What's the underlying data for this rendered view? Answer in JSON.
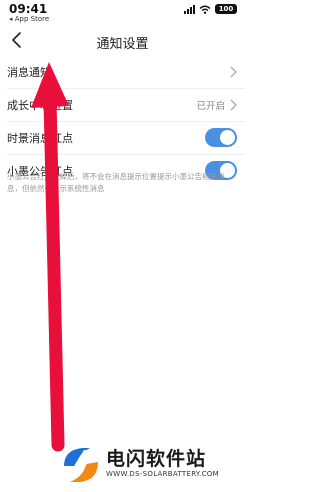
{
  "status_bar": {
    "time": "09:41",
    "back_to_app": "◂ App Store",
    "battery": "100"
  },
  "nav": {
    "title": "通知设置"
  },
  "settings": {
    "rows": [
      {
        "label": "消息通知",
        "value": "",
        "control": "chevron"
      },
      {
        "label": "成长中心位置",
        "value": "已开启",
        "control": "chevron"
      },
      {
        "label": "时景消息红点",
        "value": "",
        "control": "toggle",
        "on": true
      },
      {
        "label": "小墨公告红点",
        "value": "",
        "control": "toggle",
        "on": true
      }
    ],
    "note": "小墨公告红点关掉后，将不会在消息提示位置提示小墨公告相关消息，但依然会提示系统性消息"
  },
  "colors": {
    "toggle_on": "#4a90e2",
    "annotation_arrow": "#e8103a"
  },
  "watermark": {
    "title": "电闪软件站",
    "url": "WWW.DS-SOLARBATTERY.COM"
  }
}
